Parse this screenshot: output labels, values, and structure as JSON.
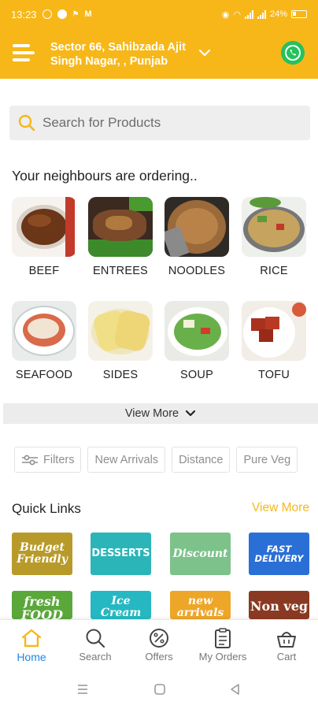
{
  "status_bar": {
    "time": "13:23",
    "battery": "24%"
  },
  "header": {
    "location": "Sector 66, Sahibzada Ajit Singh Nagar, , Punjab",
    "location_line1": "Sector 66, Sahibzada Ajit",
    "location_line2": "Singh Nagar, , Punjab"
  },
  "search": {
    "placeholder": "Search for Products"
  },
  "neighbours": {
    "title": "Your neighbours are ordering..",
    "categories": [
      {
        "label": "BEEF"
      },
      {
        "label": "ENTREES"
      },
      {
        "label": "NOODLES"
      },
      {
        "label": "RICE"
      },
      {
        "label": "SEAFOOD"
      },
      {
        "label": "SIDES"
      },
      {
        "label": "SOUP"
      },
      {
        "label": "TOFU"
      }
    ],
    "view_more": "View More"
  },
  "filters": [
    {
      "label": "Filters"
    },
    {
      "label": "New Arrivals"
    },
    {
      "label": "Distance"
    },
    {
      "label": "Pure Veg"
    }
  ],
  "quick_links": {
    "title": "Quick Links",
    "view_more": "View More",
    "tiles": [
      {
        "line1": "Budget",
        "line2": "Friendly",
        "color": "#b89a2a"
      },
      {
        "line1": "DESSERTS",
        "line2": "",
        "color": "#2bb5b8"
      },
      {
        "line1": "Discount",
        "line2": "",
        "color": "#7cc28a"
      },
      {
        "line1": "FAST",
        "line2": "DELIVERY",
        "color": "#2a6fd6"
      },
      {
        "line1": "fresh",
        "line2": "FOOD",
        "color": "#5aa83a"
      },
      {
        "line1": "Ice",
        "line2": "Cream",
        "color": "#26b8c2"
      },
      {
        "line1": "new",
        "line2": "arrivals",
        "color": "#eea629"
      },
      {
        "line1": "Non veg",
        "line2": "",
        "color": "#8a3a22"
      }
    ]
  },
  "bottom_nav": [
    {
      "label": "Home",
      "active": true,
      "icon": "home-icon"
    },
    {
      "label": "Search",
      "active": false,
      "icon": "search-icon"
    },
    {
      "label": "Offers",
      "active": false,
      "icon": "percent-icon"
    },
    {
      "label": "My Orders",
      "active": false,
      "icon": "orders-icon"
    },
    {
      "label": "Cart",
      "active": false,
      "icon": "cart-icon"
    }
  ],
  "colors": {
    "brand": "#f7b718",
    "active_nav": "#1e88e5",
    "whatsapp": "#24c25c"
  }
}
